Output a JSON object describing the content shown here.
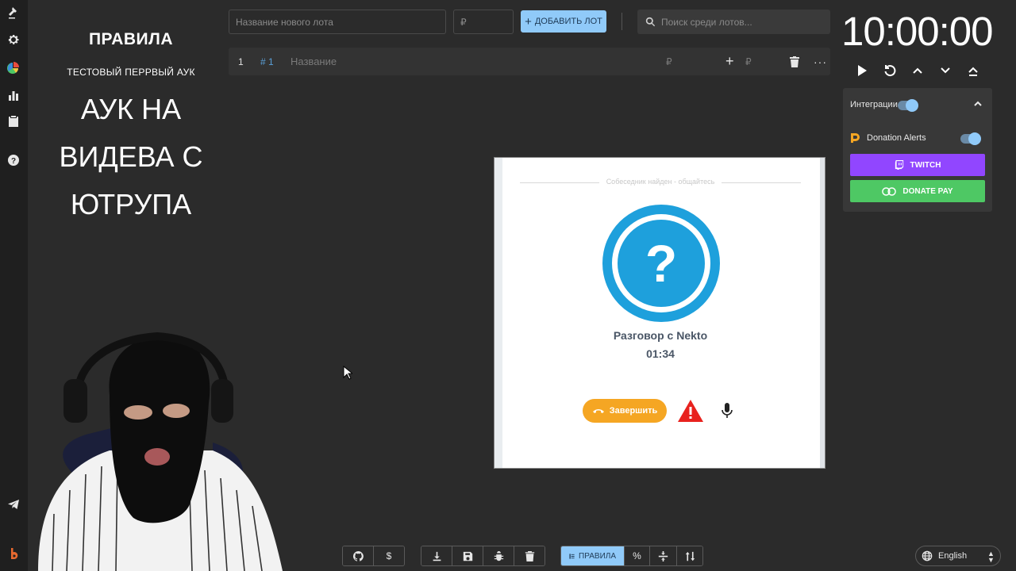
{
  "sidebar": {
    "icons": [
      "gavel-icon",
      "gear-icon",
      "pie-chart-icon",
      "bar-chart-icon",
      "clipboard-icon",
      "help-icon",
      "telegram-icon",
      "brand-logo-icon"
    ]
  },
  "rules": {
    "title": "ПРАВИЛА",
    "subtitle": "ТЕСТОВЫЙ ПЕРРВЫЙ АУК",
    "lines": [
      "АУК НА",
      "ВИДЕВА С",
      "ЮТРУПА"
    ]
  },
  "topbar": {
    "lot_name_placeholder": "Название нового лота",
    "lot_price_placeholder": "₽",
    "add_lot_label": "ДОБАВИТЬ ЛОТ",
    "search_placeholder": "Поиск среди лотов..."
  },
  "lot": {
    "index": "1",
    "id": "# 1",
    "name_placeholder": "Название",
    "price_placeholder": "₽",
    "plus": "+",
    "extra_price_placeholder": "₽",
    "more": "···"
  },
  "timer": {
    "display": "10:00:00"
  },
  "integrations": {
    "label": "Интеграции",
    "enabled": true,
    "donation_alerts_label": "Donation Alerts",
    "donation_alerts_enabled": true,
    "twitch_label": "TWITCH",
    "donatepay_label": "DONATE PAY",
    "colors": {
      "twitch": "#9146ff",
      "donatepay": "#4ec864",
      "accent": "#90caf9"
    }
  },
  "nekto": {
    "status": "Собеседник найден - общайтесь",
    "conversation_label": "Разговор с Nekto",
    "call_time": "01:34",
    "end_label": "Завершить",
    "colors": {
      "avatar": "#1ea0dc",
      "end": "#f5a623",
      "warn": "#e8221e"
    }
  },
  "bottom_toolbar": {
    "rules_label": "ПРАВИЛА",
    "currency_symbol": "$",
    "percent_symbol": "%"
  },
  "language": {
    "selected": "English"
  }
}
